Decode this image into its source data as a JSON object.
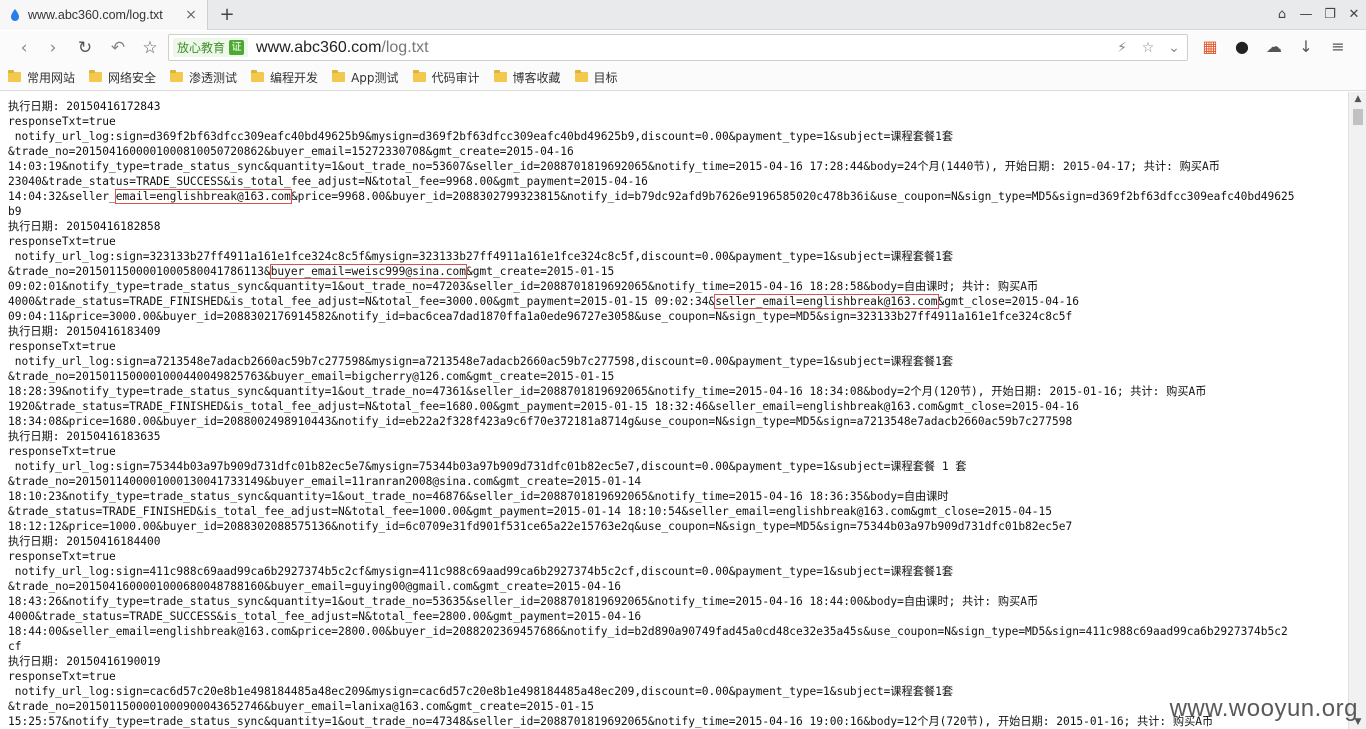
{
  "tab": {
    "title": "www.abc360.com/log.txt",
    "close": "×",
    "new_tab": "+"
  },
  "window": {
    "pin": "⌂",
    "minimize": "—",
    "maximize": "❐",
    "close": "✕"
  },
  "toolbar": {
    "back": "‹",
    "forward": "›",
    "reload": "↻",
    "undo": "↶",
    "star": "☆",
    "trust_text": "放心教育",
    "trust_check": "证",
    "url_host": "www.abc360.com",
    "url_path": "/log.txt",
    "bolt": "⚡",
    "star2": "☆",
    "dropdown": "⌄"
  },
  "extensions": {
    "apps": "▦",
    "qq": "●",
    "cloud": "☁",
    "download": "↓",
    "menu": "≡"
  },
  "bookmarks": [
    "常用网站",
    "网络安全",
    "渗透测试",
    "编程开发",
    "App测试",
    "代码审计",
    "博客收藏",
    "目标"
  ],
  "log_lines": [
    "执行日期: 20150416172843",
    "responseTxt=true",
    " notify_url_log:sign=d369f2bf63dfcc309eafc40bd49625b9&mysign=d369f2bf63dfcc309eafc40bd49625b9,discount=0.00&payment_type=1&subject=课程套餐1套",
    "&trade_no=2015041600001000810050720862&buyer_email=15272330708&gmt_create=2015-04-16",
    "14:03:19&notify_type=trade_status_sync&quantity=1&out_trade_no=53607&seller_id=2088701819692065&notify_time=2015-04-16 17:28:44&body=24个月(1440节), 开始日期: 2015-04-17; 共计: 购买A币",
    "23040&trade_status=TRADE_SUCCESS&is_total_fee_adjust=N&total_fee=9968.00&gmt_payment=2015-04-16",
    "14:04:32&seller_email=englishbreak@163.com&price=9968.00&buyer_id=2088302799323815&notify_id=b79dc92afd9b7626e9196585020c478b36i&use_coupon=N&sign_type=MD5&sign=d369f2bf63dfcc309eafc40bd49625",
    "b9",
    "执行日期: 20150416182858",
    "responseTxt=true",
    " notify_url_log:sign=323133b27ff4911a161e1fce324c8c5f&mysign=323133b27ff4911a161e1fce324c8c5f,discount=0.00&payment_type=1&subject=课程套餐1套",
    "&trade_no=2015011500001000580041786113&buyer_email=weisc999@sina.com&gmt_create=2015-01-15",
    "09:02:01&notify_type=trade_status_sync&quantity=1&out_trade_no=47203&seller_id=2088701819692065&notify_time=2015-04-16 18:28:58&body=自由课时; 共计: 购买A币",
    "4000&trade_status=TRADE_FINISHED&is_total_fee_adjust=N&total_fee=3000.00&gmt_payment=2015-01-15 09:02:34&seller_email=englishbreak@163.com&gmt_close=2015-04-16",
    "09:04:11&price=3000.00&buyer_id=2088302176914582&notify_id=bac6cea7dad1870ffa1a0ede96727e3058&use_coupon=N&sign_type=MD5&sign=323133b27ff4911a161e1fce324c8c5f",
    "执行日期: 20150416183409",
    "responseTxt=true",
    " notify_url_log:sign=a7213548e7adacb2660ac59b7c277598&mysign=a7213548e7adacb2660ac59b7c277598,discount=0.00&payment_type=1&subject=课程套餐1套",
    "&trade_no=2015011500001000440049825763&buyer_email=bigcherry@126.com&gmt_create=2015-01-15",
    "18:28:39&notify_type=trade_status_sync&quantity=1&out_trade_no=47361&seller_id=2088701819692065&notify_time=2015-04-16 18:34:08&body=2个月(120节), 开始日期: 2015-01-16; 共计: 购买A币",
    "1920&trade_status=TRADE_FINISHED&is_total_fee_adjust=N&total_fee=1680.00&gmt_payment=2015-01-15 18:32:46&seller_email=englishbreak@163.com&gmt_close=2015-04-16",
    "18:34:08&price=1680.00&buyer_id=2088002498910443&notify_id=eb22a2f328f423a9c6f70e372181a8714g&use_coupon=N&sign_type=MD5&sign=a7213548e7adacb2660ac59b7c277598",
    "执行日期: 20150416183635",
    "responseTxt=true",
    " notify_url_log:sign=75344b03a97b909d731dfc01b82ec5e7&mysign=75344b03a97b909d731dfc01b82ec5e7,discount=0.00&payment_type=1&subject=课程套餐 1 套",
    "&trade_no=2015011400001000130041733149&buyer_email=11ranran2008@sina.com&gmt_create=2015-01-14",
    "18:10:23&notify_type=trade_status_sync&quantity=1&out_trade_no=46876&seller_id=2088701819692065&notify_time=2015-04-16 18:36:35&body=自由课时",
    "&trade_status=TRADE_FINISHED&is_total_fee_adjust=N&total_fee=1000.00&gmt_payment=2015-01-14 18:10:54&seller_email=englishbreak@163.com&gmt_close=2015-04-15",
    "18:12:12&price=1000.00&buyer_id=2088302088575136&notify_id=6c0709e31fd901f531ce65a22e15763e2q&use_coupon=N&sign_type=MD5&sign=75344b03a97b909d731dfc01b82ec5e7",
    "执行日期: 20150416184400",
    "responseTxt=true",
    " notify_url_log:sign=411c988c69aad99ca6b2927374b5c2cf&mysign=411c988c69aad99ca6b2927374b5c2cf,discount=0.00&payment_type=1&subject=课程套餐1套",
    "&trade_no=2015041600001000680048788160&buyer_email=guying00@gmail.com&gmt_create=2015-04-16",
    "18:43:26&notify_type=trade_status_sync&quantity=1&out_trade_no=53635&seller_id=2088701819692065&notify_time=2015-04-16 18:44:00&body=自由课时; 共计: 购买A币",
    "4000&trade_status=TRADE_SUCCESS&is_total_fee_adjust=N&total_fee=2800.00&gmt_payment=2015-04-16",
    "18:44:00&seller_email=englishbreak@163.com&price=2800.00&buyer_id=2088202369457686&notify_id=b2d890a90749fad45a0cd48ce32e35a45s&use_coupon=N&sign_type=MD5&sign=411c988c69aad99ca6b2927374b5c2",
    "cf",
    "执行日期: 20150416190019",
    "responseTxt=true",
    " notify_url_log:sign=cac6d57c20e8b1e498184485a48ec209&mysign=cac6d57c20e8b1e498184485a48ec209,discount=0.00&payment_type=1&subject=课程套餐1套",
    "&trade_no=2015011500001000900043652746&buyer_email=lanixa@163.com&gmt_create=2015-01-15",
    "15:25:57&notify_type=trade_status_sync&quantity=1&out_trade_no=47348&seller_id=2088701819692065&notify_time=2015-04-16 19:00:16&body=12个月(720节), 开始日期: 2015-01-16; 共计: 购买A币"
  ],
  "scrollbar": {
    "up": "▲",
    "down": "▼"
  },
  "watermark": "www.wooyun.org"
}
